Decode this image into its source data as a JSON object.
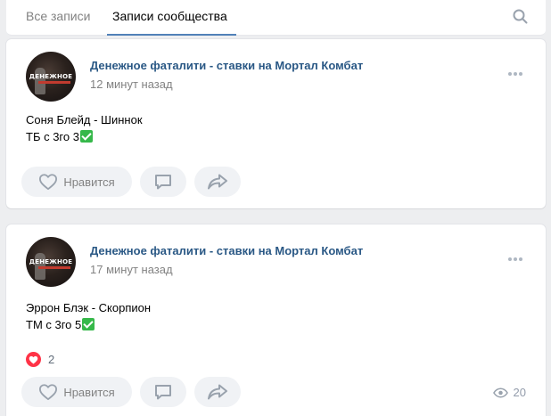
{
  "tabs": [
    {
      "label": "Все записи",
      "active": false
    },
    {
      "label": "Записи сообщества",
      "active": true
    }
  ],
  "accent_color": "#5181b8",
  "link_color": "#2a5885",
  "posts": [
    {
      "author": "Денежное фаталити - ставки на Мортал Комбат",
      "avatar_text": "ДЕНЕЖНОЕ",
      "time": "12 минут назад",
      "lines": [
        "Соня Блейд - Шиннок",
        "ТБ с 3го 3"
      ],
      "like_label": "Нравится"
    },
    {
      "author": "Денежное фаталити - ставки на Мортал Комбат",
      "avatar_text": "ДЕНЕЖНОЕ",
      "time": "17 минут назад",
      "lines": [
        "Эррон Блэк - Скорпион",
        "ТМ с 3го 5"
      ],
      "reactions_count": "2",
      "like_label": "Нравится",
      "views": "20"
    }
  ]
}
